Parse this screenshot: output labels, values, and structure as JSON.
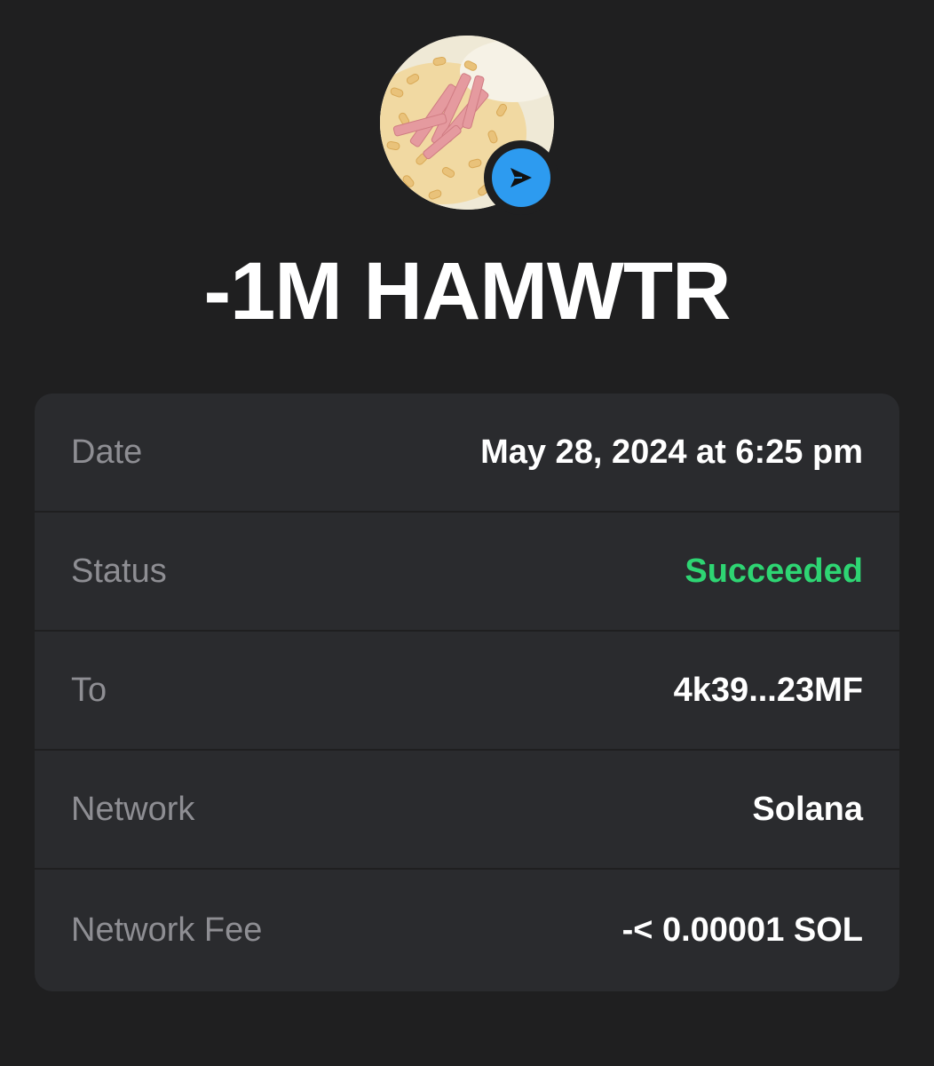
{
  "token": {
    "avatar_icon": "mac-and-cheese-with-ham-image",
    "badge_icon": "send-arrow-icon",
    "badge_color": "#2d9bf0"
  },
  "transaction": {
    "amount": "-1M HAMWTR"
  },
  "details": {
    "date_label": "Date",
    "date_value": "May 28, 2024 at 6:25 pm",
    "status_label": "Status",
    "status_value": "Succeeded",
    "status_color": "#2ed573",
    "to_label": "To",
    "to_value": "4k39...23MF",
    "network_label": "Network",
    "network_value": "Solana",
    "fee_label": "Network Fee",
    "fee_value": "-< 0.00001 SOL"
  }
}
